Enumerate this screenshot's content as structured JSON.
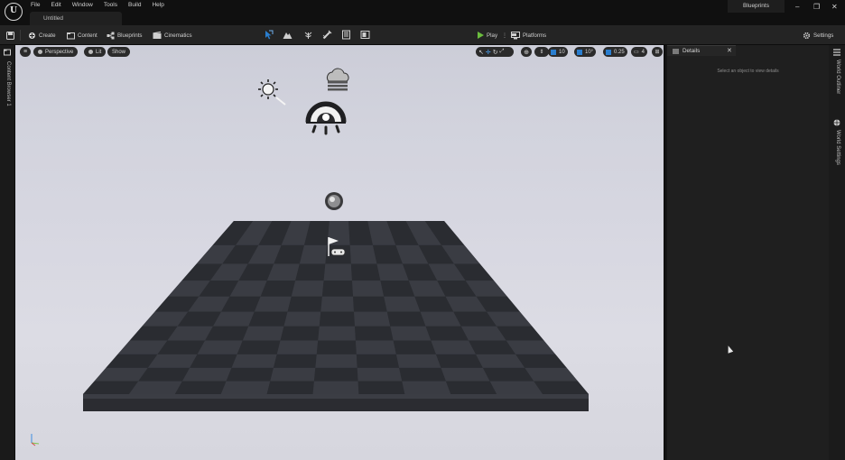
{
  "menu": [
    "File",
    "Edit",
    "Window",
    "Tools",
    "Build",
    "Help"
  ],
  "document_tab": "Untitled",
  "blueprints_tab": "Blueprints",
  "window_controls": {
    "minimize": "–",
    "restore": "❐",
    "close": "✕"
  },
  "toolbar": {
    "create": "Create",
    "content": "Content",
    "blueprints": "Blueprints",
    "cinematics": "Cinematics",
    "play": "Play",
    "platforms": "Platforms",
    "settings": "Settings"
  },
  "left_strip": {
    "label": "Content Browser 1"
  },
  "viewport_bar": {
    "view_mode": "Perspective",
    "lighting": "Lit",
    "show": "Show",
    "grid_snap": "10",
    "rotation_snap": "10°",
    "scale_snap": "0.25",
    "camera_speed": "4"
  },
  "details": {
    "tab_title": "Details",
    "close": "✕",
    "empty_message": "Select an object to view details"
  },
  "right_strip": {
    "outliner": "World Outliner",
    "world_settings": "World Settings"
  },
  "icons": [
    "ue-logo-icon",
    "save-icon",
    "create-icon",
    "content-icon",
    "blueprints-icon",
    "cinematics-icon",
    "select-mode-icon",
    "landscape-mode-icon",
    "foliage-mode-icon",
    "mesh-paint-mode-icon",
    "fracture-mode-icon",
    "brush-mode-icon",
    "play-icon",
    "platforms-icon",
    "settings-icon",
    "sun-icon",
    "sky-atmosphere-icon",
    "sky-light-icon",
    "sphere-reflection-icon",
    "player-start-icon",
    "axis-gizmo-icon"
  ],
  "colors": {
    "play_green": "#6bbd3e",
    "accent_blue": "#2a7ecf",
    "sky_light": "#d6d6de",
    "floor_dark": "#2f3137"
  }
}
